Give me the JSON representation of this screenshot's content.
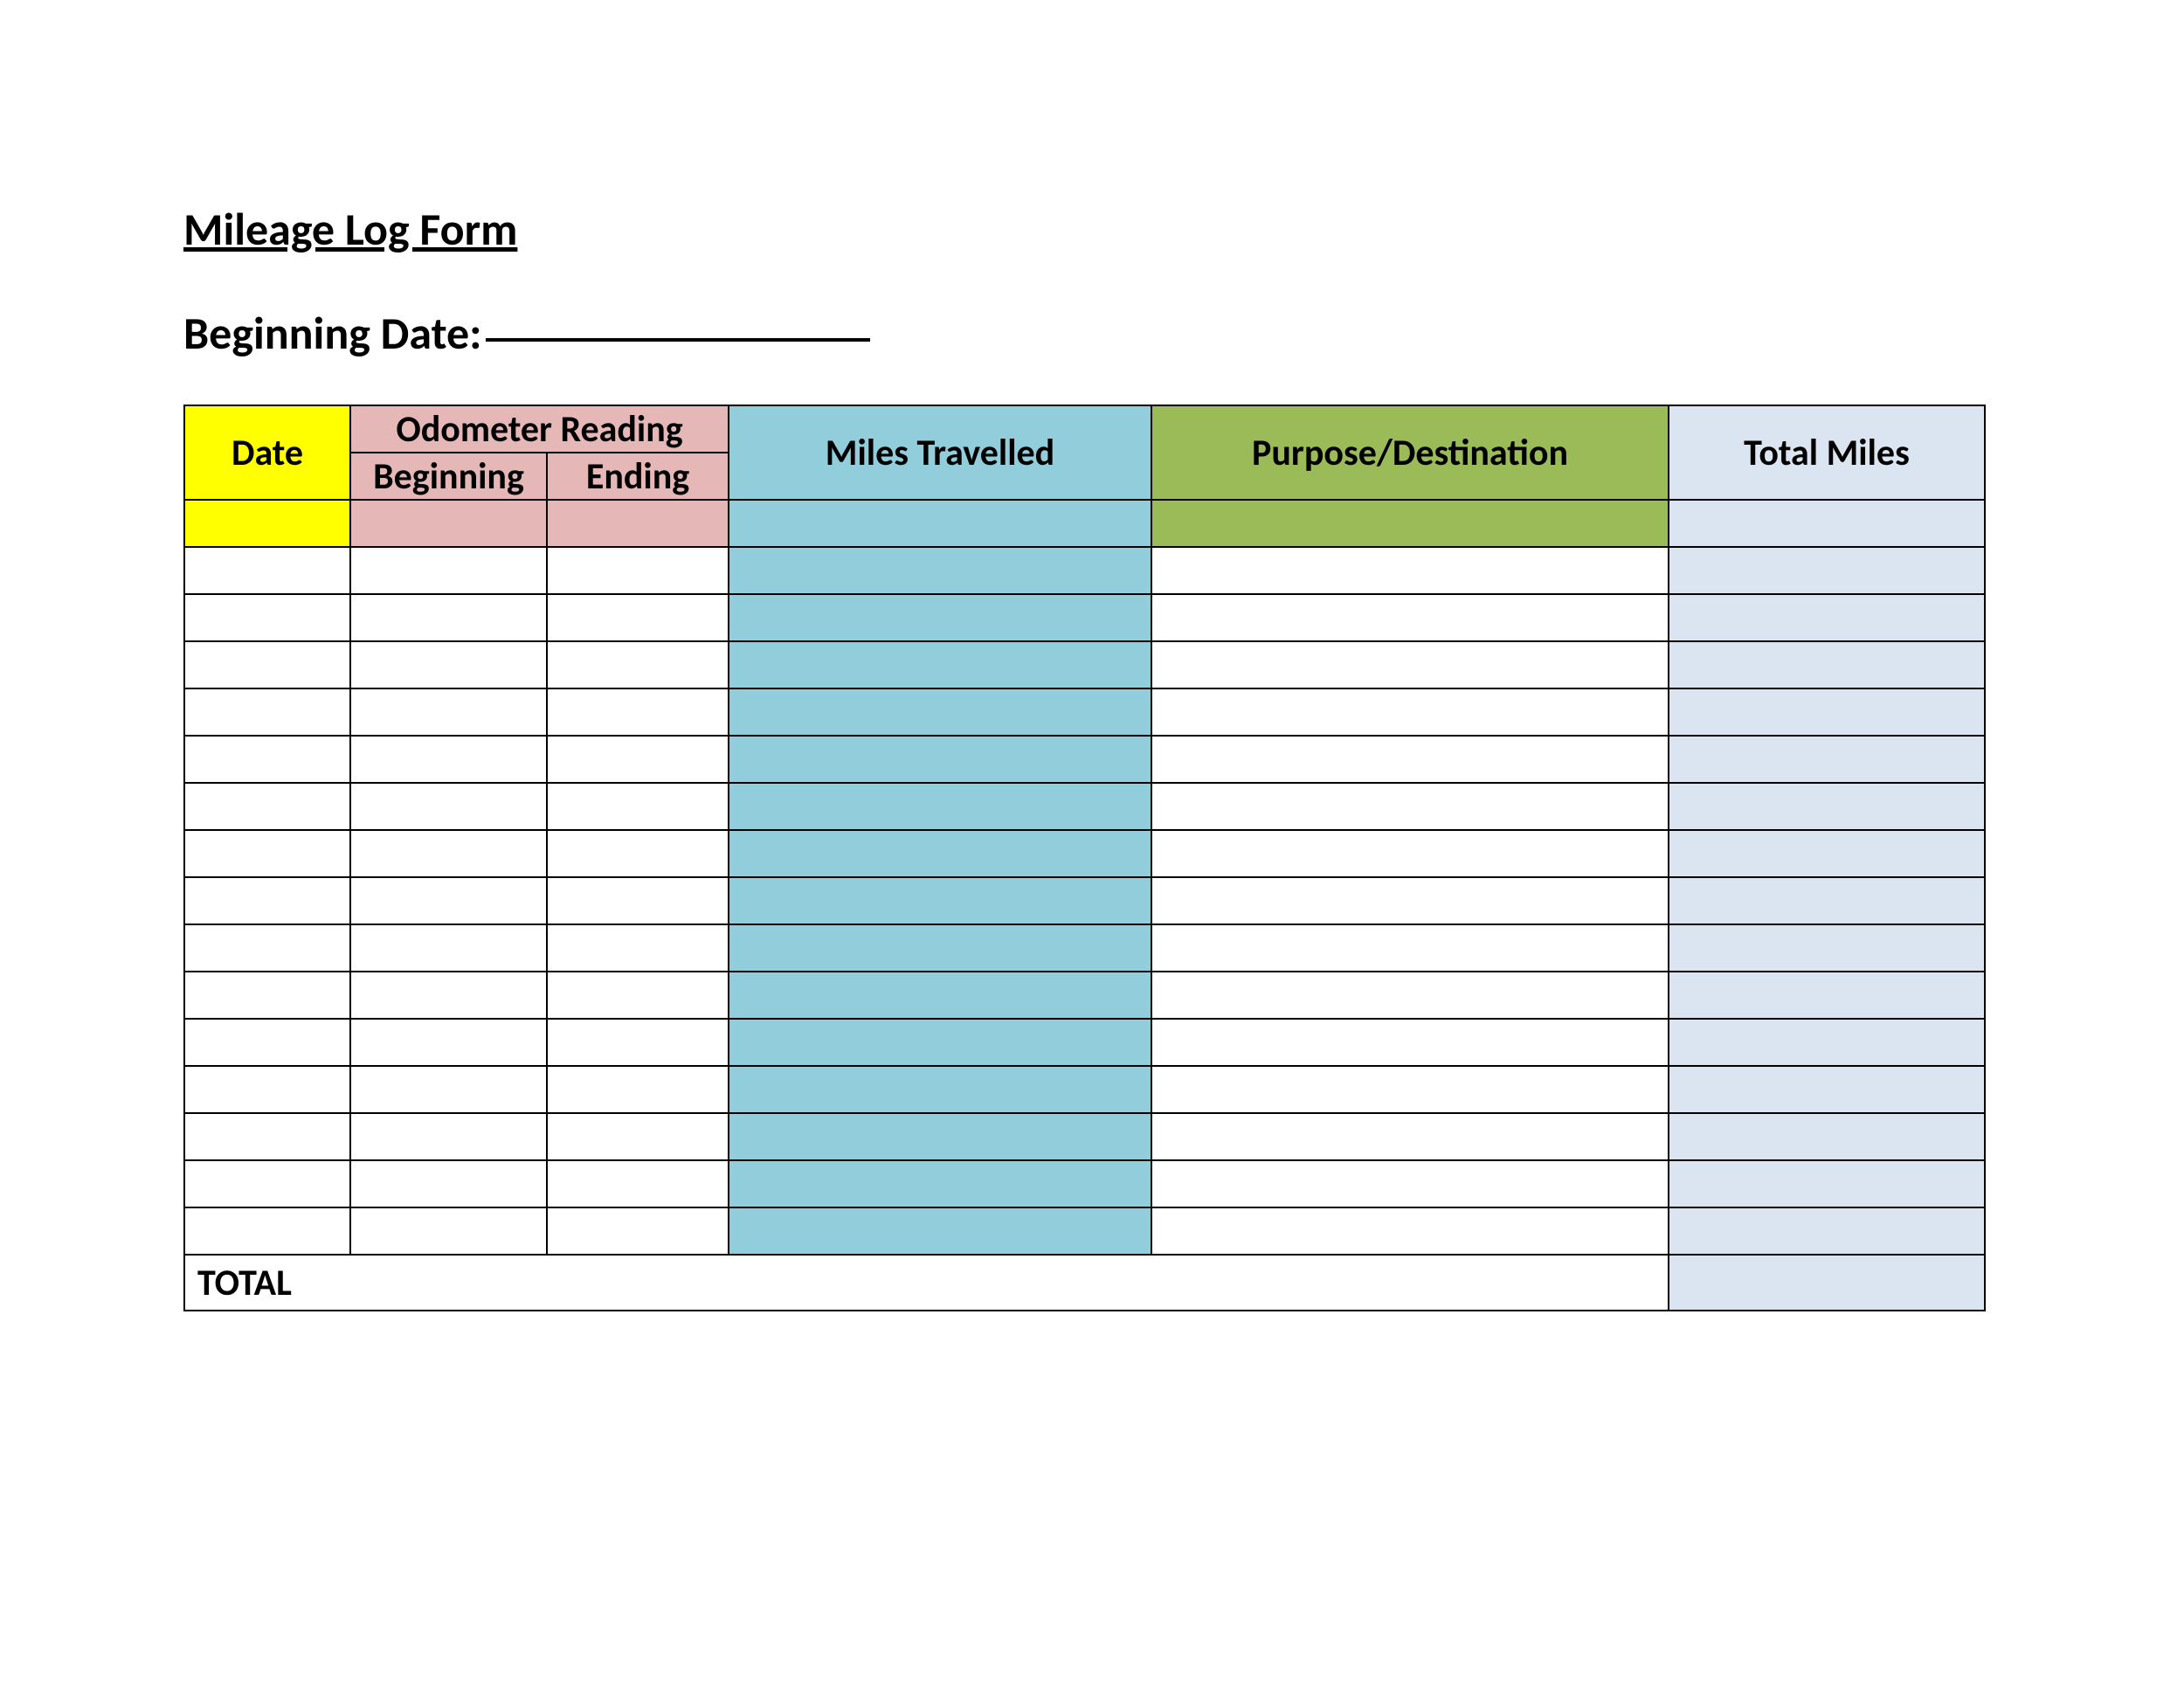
{
  "title": "Mileage Log Form",
  "beginning_date_label": "Beginning Date:",
  "headers": {
    "date": "Date",
    "odometer": "Odometer Reading",
    "beginning": "Beginning",
    "ending": "Ending",
    "miles_travelled": "Miles Travelled",
    "purpose": "Purpose/Destination",
    "total_miles": "Total Miles"
  },
  "total_label": "TOTAL",
  "rows": 15,
  "colors": {
    "yellow": "#ffff00",
    "pink": "#e5b8b7",
    "teal": "#92cddc",
    "green": "#9bbb59",
    "ltblue": "#dbe5f1"
  }
}
